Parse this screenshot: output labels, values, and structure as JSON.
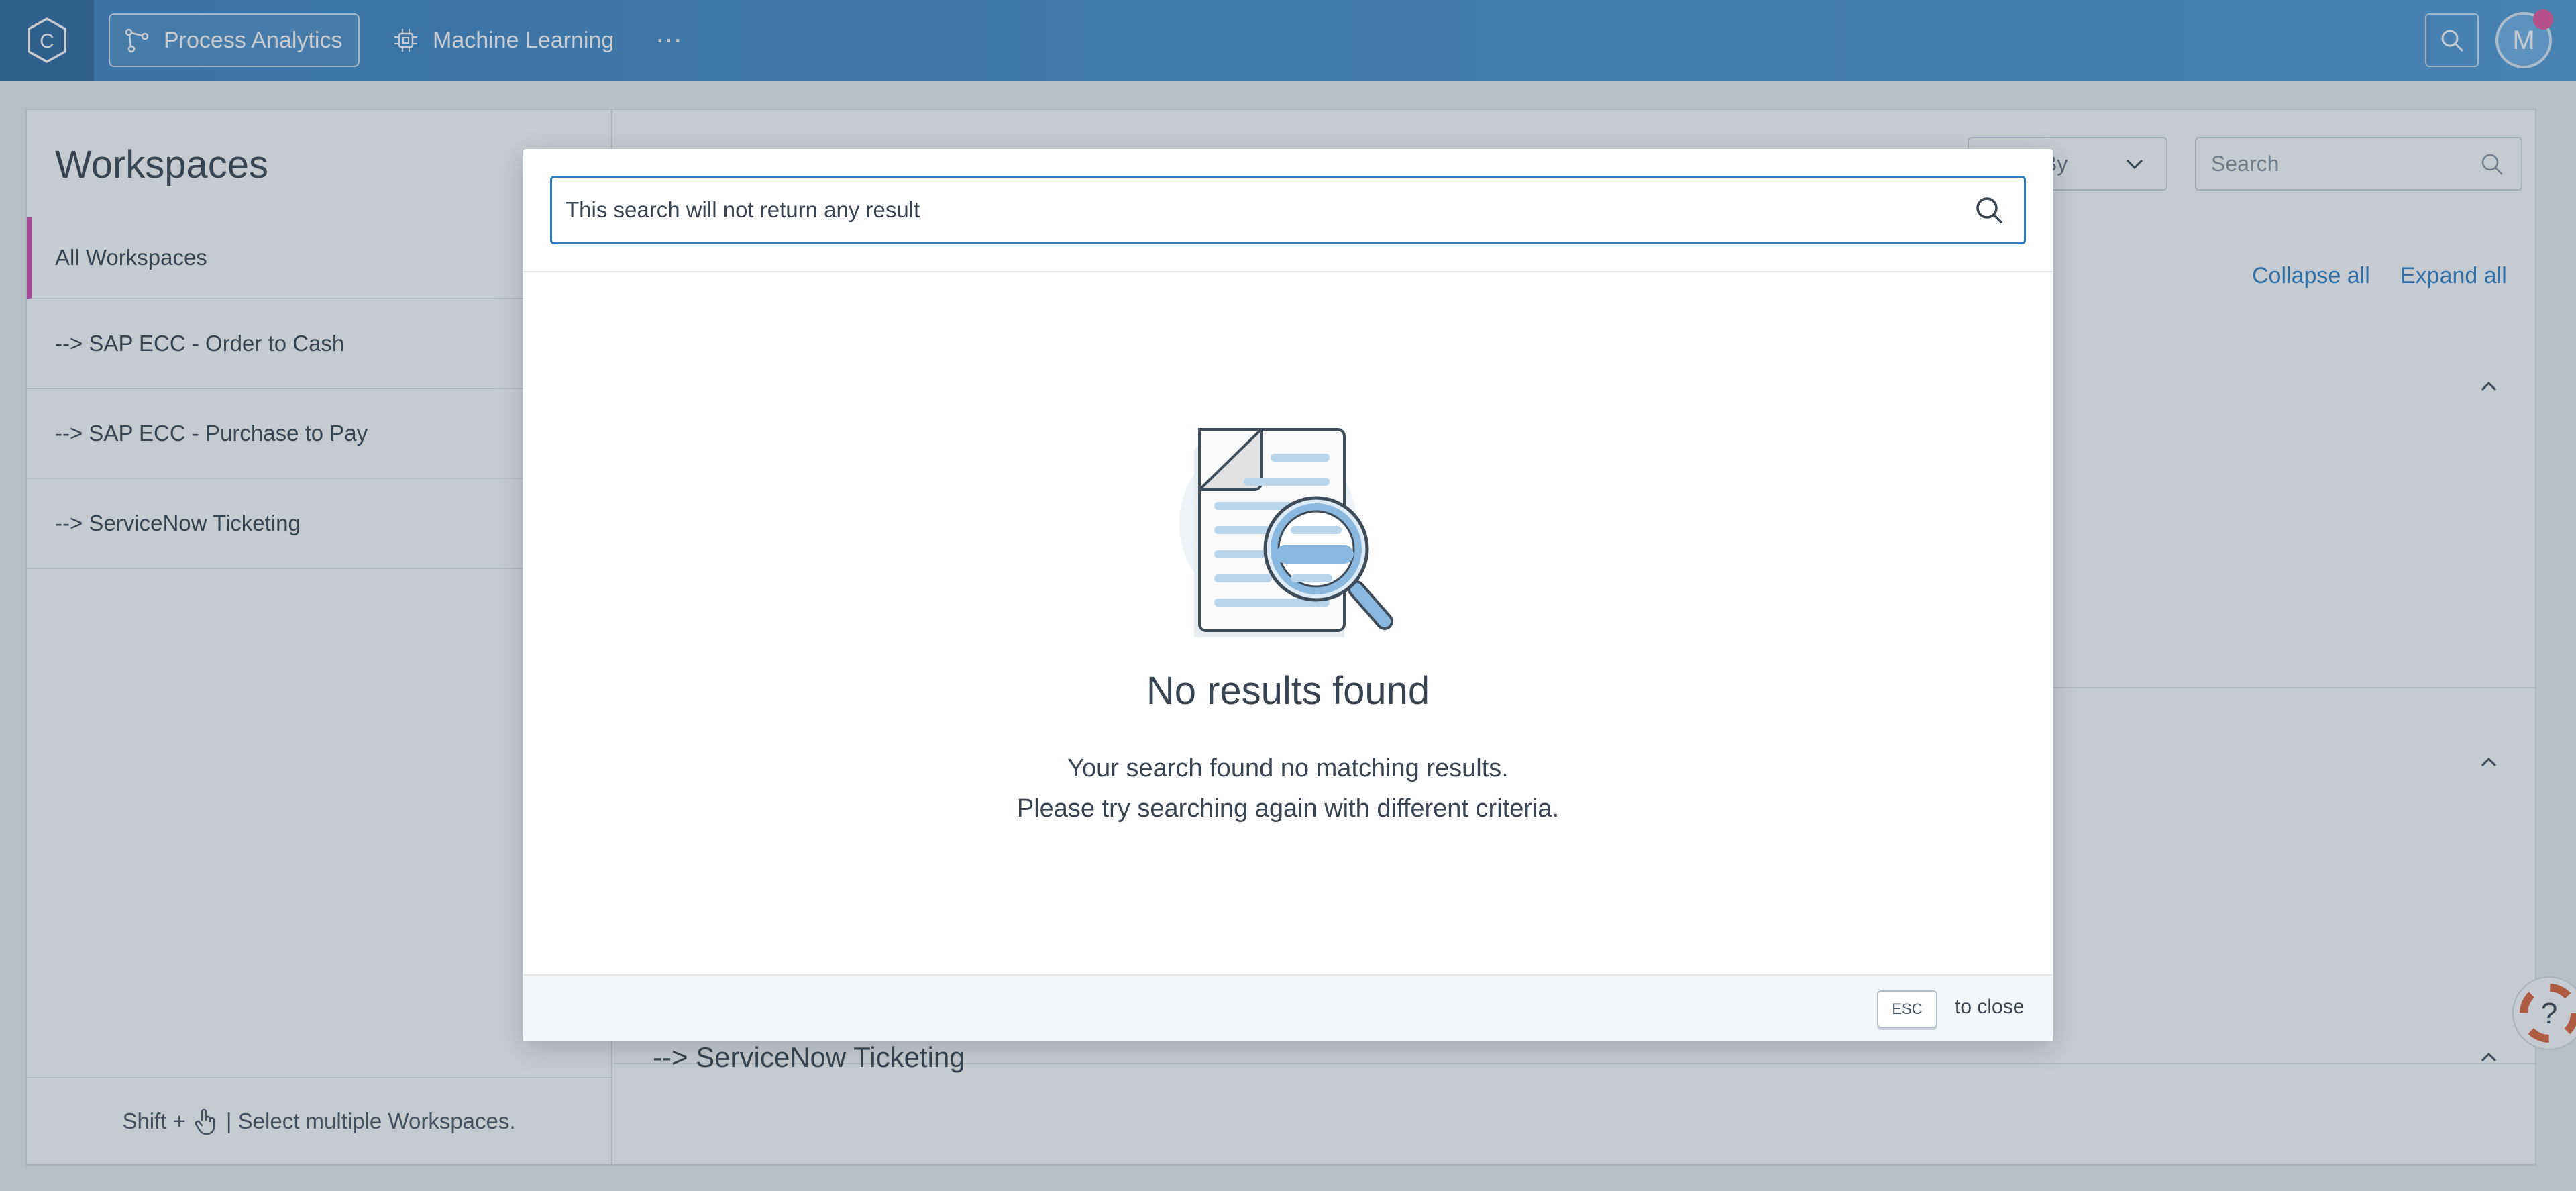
{
  "topbar": {
    "logo_letter": "C",
    "nav": [
      {
        "label": "Process Analytics",
        "active": true
      },
      {
        "label": "Machine Learning",
        "active": false
      }
    ],
    "more_label": "⋯",
    "avatar_initial": "M",
    "accent_color": "#4a94cf"
  },
  "sidebar": {
    "title": "Workspaces",
    "items": [
      {
        "label": "All Workspaces",
        "selected": true
      },
      {
        "label": "--> SAP ECC - Order to Cash"
      },
      {
        "label": "--> SAP ECC - Purchase to Pay"
      },
      {
        "label": "--> ServiceNow Ticketing"
      }
    ],
    "footer_prefix": "Shift +",
    "footer_suffix": "| Select multiple Workspaces."
  },
  "main": {
    "group_by_label": "By",
    "search_placeholder": "Search",
    "collapse_all": "Collapse all",
    "expand_all": "Expand all",
    "section_title": "--> ServiceNow Ticketing"
  },
  "modal": {
    "search_value": "This search will not return any result",
    "empty_title": "No results found",
    "empty_line1": "Your search found no matching results.",
    "empty_line2": "Please try searching again with different criteria.",
    "esc_key": "ESC",
    "esc_text": "to close"
  }
}
